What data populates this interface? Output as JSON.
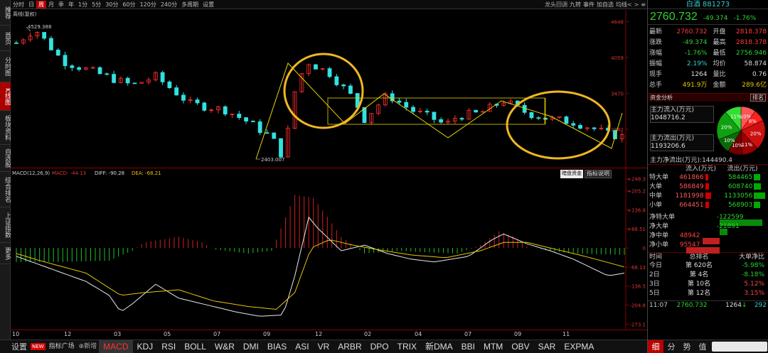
{
  "left_nav": [
    "推荐",
    "首页",
    "分时图",
    "K线图",
    "板块资料",
    "自选股",
    "综合排名",
    "上证指数",
    "更多"
  ],
  "top_bar": {
    "items": [
      "分时",
      "日",
      "周",
      "月",
      "季",
      "年",
      "1分",
      "5分",
      "30分",
      "60分",
      "120分",
      "240分",
      "多周期",
      "设置"
    ],
    "active": "周",
    "right_items": [
      "龙头回调",
      "九转",
      "事件",
      "加自选",
      "均线"
    ],
    "icons": [
      "<",
      ">",
      "≡"
    ]
  },
  "kline": {
    "title": "周线(复权)",
    "high_label": "4529.388",
    "low_label": "2403.007",
    "y_axis": [
      "4648",
      "4059",
      "3470",
      "2882"
    ],
    "last_label": "白酒"
  },
  "macd": {
    "label": "MACD(12,26,9)",
    "macd_text": "MACD: -44.13",
    "diff_text": "DIFF: -90.28",
    "dea_text": "DEA: -68.21",
    "y_axis": [
      "+248.3",
      "+205.2",
      "+136.8",
      "+68.51",
      "0",
      "-68.13",
      "-136.5",
      "-204.8",
      "-273.1"
    ],
    "buttons": [
      "暗盘资金",
      "指标说明"
    ]
  },
  "time_axis": [
    "10",
    "12",
    "03",
    "05",
    "07",
    "09",
    "12",
    "02",
    "04",
    "07",
    "09",
    "11"
  ],
  "bottom_bar": {
    "left": [
      "设置",
      "NEW",
      "指标广场",
      "新增"
    ],
    "indicators": [
      "MACD",
      "KDJ",
      "RSI",
      "BOLL",
      "W&R",
      "DMI",
      "BIAS",
      "ASI",
      "VR",
      "ARBR",
      "DPO",
      "TRIX",
      "新DMA",
      "BBI",
      "MTM",
      "OBV",
      "SAR",
      "EXPMA"
    ],
    "active": "MACD"
  },
  "quote": {
    "name": "白酒",
    "code": "881273",
    "price": "2760.732",
    "change": "-49.374",
    "pct": "-1.76%",
    "rows": [
      {
        "l1": "最新",
        "v1": "2760.732",
        "l2": "开盘",
        "v2": "2818.378",
        "c1": "red",
        "c2": "red"
      },
      {
        "l1": "涨跌",
        "v1": "-49.374",
        "l2": "最高",
        "v2": "2818.378",
        "c1": "green",
        "c2": "red"
      },
      {
        "l1": "涨幅",
        "v1": "-1.76%",
        "l2": "最低",
        "v2": "2756.946",
        "c1": "green",
        "c2": "green"
      },
      {
        "l1": "振幅",
        "v1": "2.19%",
        "l2": "均价",
        "v2": "58.874",
        "c1": "cyan",
        "c2": "white"
      },
      {
        "l1": "现手",
        "v1": "1264",
        "l2": "量比",
        "v2": "0.76",
        "c1": "white",
        "c2": "white"
      },
      {
        "l1": "总手",
        "v1": "491.9万",
        "l2": "金额",
        "v2": "289.6亿",
        "c1": "yellow",
        "c2": "yellow"
      }
    ]
  },
  "fund": {
    "title": "资金分析",
    "tab": "排名",
    "in_label": "主力流入(万元)",
    "in_val": "1048716.2",
    "out_label": "主力流出(万元)",
    "out_val": "1193206.6",
    "net_label": "主力净流出(万元):",
    "net_val": "144490.4",
    "pie": {
      "slices": [
        {
          "label": "10%",
          "value": 10,
          "color": "#ff5555"
        },
        {
          "label": "8%",
          "value": 8,
          "color": "#ff2020"
        },
        {
          "label": "20%",
          "value": 20,
          "color": "#cc1010"
        },
        {
          "label": "11%",
          "value": 11,
          "color": "#990000"
        },
        {
          "label": "10%",
          "value": 10,
          "color": "#700000"
        },
        {
          "label": "10%",
          "value": 10,
          "color": "#0a6a0a"
        },
        {
          "label": "20%",
          "value": 20,
          "color": "#11a011"
        },
        {
          "label": "11%",
          "value": 11,
          "color": "#33dd33"
        }
      ]
    },
    "header": {
      "in": "流入(万元)",
      "out": "流出(万元)"
    },
    "flow_rows": [
      {
        "name": "特大单",
        "in": "461866",
        "out": "584465",
        "in_frac": 0.5,
        "out_frac": 0.55
      },
      {
        "name": "大单",
        "in": "586849",
        "out": "608740",
        "in_frac": 0.6,
        "out_frac": 0.6
      },
      {
        "name": "中单",
        "in": "1181998",
        "out": "1133056",
        "in_frac": 1.0,
        "out_frac": 1.0
      },
      {
        "name": "小单",
        "in": "664451",
        "out": "568903",
        "in_frac": 0.65,
        "out_frac": 0.55
      }
    ],
    "net_rows": [
      {
        "name": "净特大单",
        "val": "-122599",
        "color": "green",
        "frac": 1.0
      },
      {
        "name": "净大单",
        "val": "-21891",
        "color": "green",
        "frac": 0.18
      },
      {
        "name": "净中单",
        "val": "48942",
        "color": "red",
        "frac": 0.4
      },
      {
        "name": "净小单",
        "val": "95547",
        "color": "red",
        "frac": 0.78
      }
    ]
  },
  "ranking": {
    "header": {
      "time": "时间",
      "rank": "总排名",
      "net": "大单净比"
    },
    "rows": [
      {
        "time": "今日",
        "rank": "第 620名",
        "net": "-5.98%"
      },
      {
        "time": "2日",
        "rank": "第 4名",
        "net": "-8.18%"
      },
      {
        "time": "3日",
        "rank": "第 10名",
        "net": "5.12%"
      },
      {
        "time": "5日",
        "rank": "第 12名",
        "net": "3.15%"
      }
    ]
  },
  "ticker": {
    "time": "11:07",
    "price": "2760.732",
    "vol": "1264",
    "extra": "292"
  },
  "bottom_tabs": [
    "细",
    "分",
    "势",
    "值"
  ]
}
